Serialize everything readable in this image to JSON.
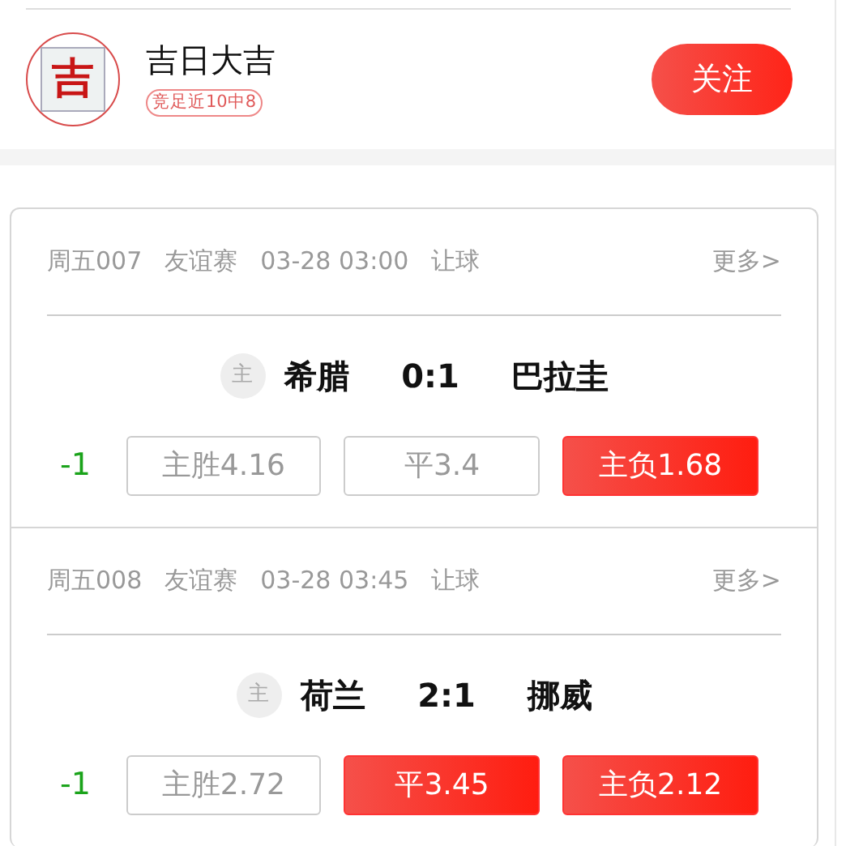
{
  "expert": {
    "avatar_text": "吉",
    "name": "吉日大吉",
    "badge": "竞足近10中8",
    "follow_button": "关注"
  },
  "matches": [
    {
      "number": "周五007",
      "league": "友谊赛",
      "time": "03-28 03:00",
      "play": "让球",
      "more": "更多>",
      "home_tag": "主",
      "home": "希腊",
      "score": "0:1",
      "away": "巴拉圭",
      "handicap": "-1",
      "odds": [
        {
          "label": "主胜4.16",
          "selected": false
        },
        {
          "label": "平3.4",
          "selected": false
        },
        {
          "label": "主负1.68",
          "selected": true
        }
      ]
    },
    {
      "number": "周五008",
      "league": "友谊赛",
      "time": "03-28 03:45",
      "play": "让球",
      "more": "更多>",
      "home_tag": "主",
      "home": "荷兰",
      "score": "2:1",
      "away": "挪威",
      "handicap": "-1",
      "odds": [
        {
          "label": "主胜2.72",
          "selected": false
        },
        {
          "label": "平3.45",
          "selected": true
        },
        {
          "label": "主负2.12",
          "selected": true
        }
      ]
    }
  ]
}
